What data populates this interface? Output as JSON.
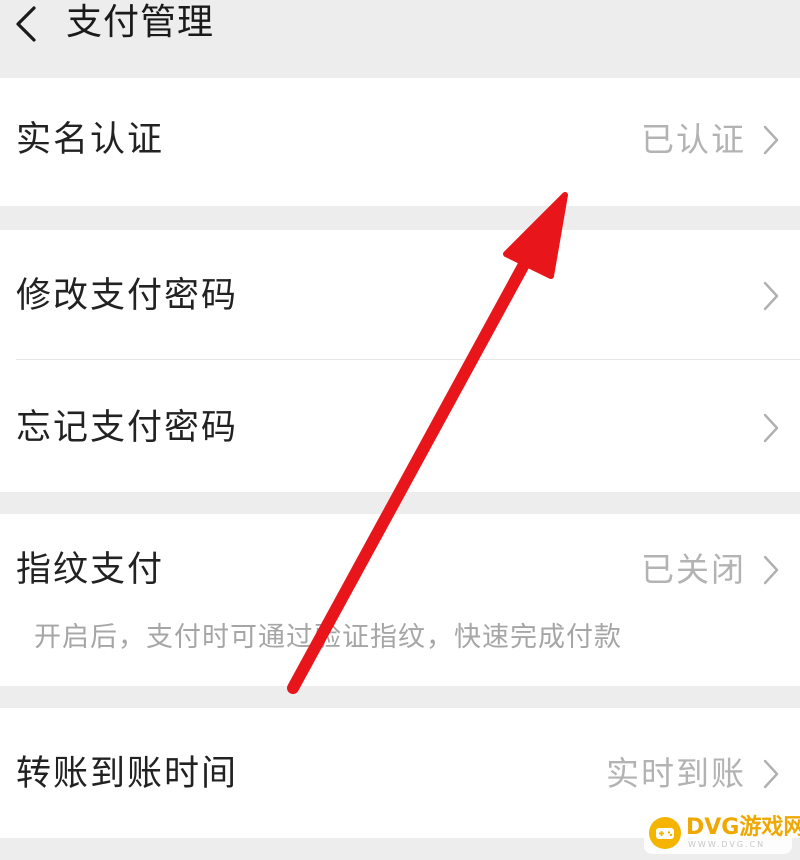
{
  "header": {
    "title": "支付管理"
  },
  "rows": [
    {
      "label": "实名认证",
      "value": "已认证"
    },
    {
      "label": "修改支付密码",
      "value": ""
    },
    {
      "label": "忘记支付密码",
      "value": ""
    },
    {
      "label": "指纹支付",
      "value": "已关闭",
      "description": "开启后，支付时可通过验证指纹，快速完成付款"
    },
    {
      "label": "转账到账时间",
      "value": "实时到账"
    }
  ],
  "annotation": {
    "arrow_color": "#e8161a"
  },
  "watermark": {
    "text": "DVG游戏网",
    "subtext": "WWW.DVG.CN"
  }
}
